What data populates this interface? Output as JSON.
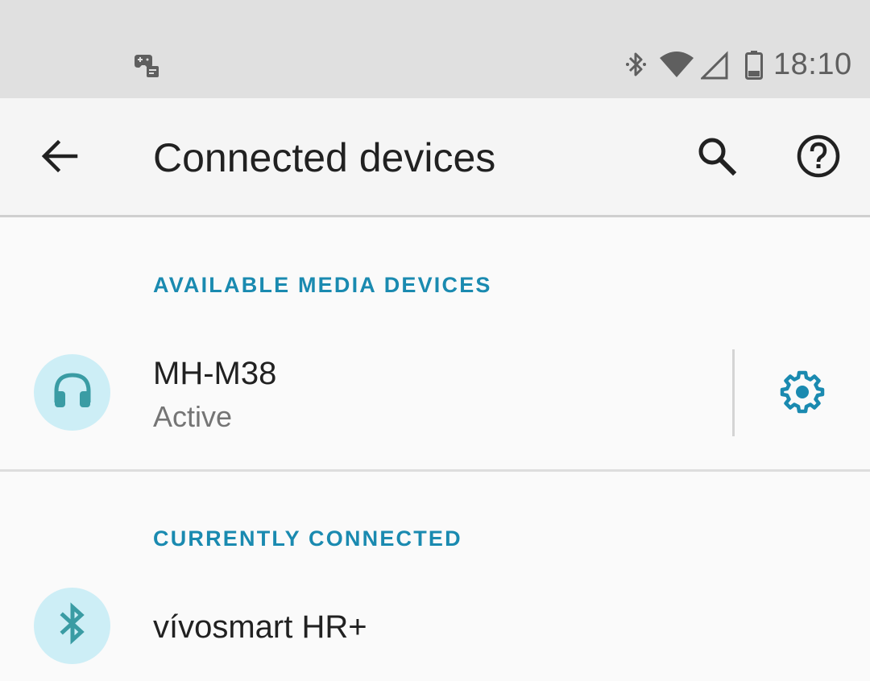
{
  "status_bar": {
    "time": "18:10",
    "icons": [
      "game-controller-notification-icon",
      "bluetooth-icon",
      "wifi-icon",
      "cell-signal-icon",
      "battery-icon"
    ]
  },
  "app_bar": {
    "title": "Connected devices",
    "back_icon": "arrow-back-icon",
    "search_icon": "search-icon",
    "help_icon": "help-icon"
  },
  "sections": {
    "available_media": {
      "header": "AVAILABLE MEDIA DEVICES",
      "device": {
        "name": "MH-M38",
        "status": "Active",
        "icon": "headphones-icon"
      }
    },
    "currently_connected": {
      "header": "CURRENTLY CONNECTED",
      "device": {
        "name": "vívosmart HR+",
        "icon": "bluetooth-icon"
      }
    }
  },
  "colors": {
    "accent": "#1a8ab0",
    "icon_teal": "#3a9ca4",
    "avatar_bg": "#cdeef6",
    "status_bar_bg": "#e0e0e0",
    "app_bar_bg": "#f5f5f5"
  }
}
